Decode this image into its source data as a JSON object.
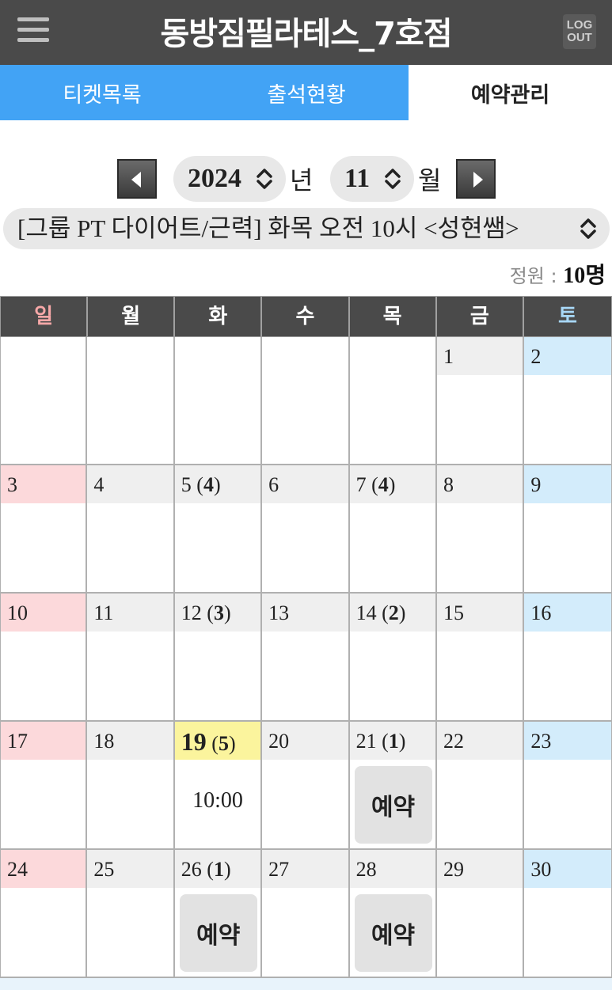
{
  "header": {
    "title": "동방짐필라테스_7호점",
    "logout_line1": "LOG",
    "logout_line2": "OUT"
  },
  "tabs": [
    {
      "label": "티켓목록",
      "active": false
    },
    {
      "label": "출석현황",
      "active": false
    },
    {
      "label": "예약관리",
      "active": true
    }
  ],
  "selector": {
    "year": "2024",
    "year_suffix": "년",
    "month": "11",
    "month_suffix": "월"
  },
  "class_select": "[그룹 PT 다이어트/근력] 화목 오전 10시 <성현쌤>",
  "capacity": {
    "label": "정원 : ",
    "value": "10명"
  },
  "weekdays": [
    "일",
    "월",
    "화",
    "수",
    "목",
    "금",
    "토"
  ],
  "weeks": [
    [
      {
        "date": "",
        "count": ""
      },
      {
        "date": "",
        "count": ""
      },
      {
        "date": "",
        "count": ""
      },
      {
        "date": "",
        "count": ""
      },
      {
        "date": "",
        "count": ""
      },
      {
        "date": "1",
        "count": ""
      },
      {
        "date": "2",
        "count": ""
      }
    ],
    [
      {
        "date": "3",
        "count": ""
      },
      {
        "date": "4",
        "count": ""
      },
      {
        "date": "5",
        "count": "4"
      },
      {
        "date": "6",
        "count": ""
      },
      {
        "date": "7",
        "count": "4"
      },
      {
        "date": "8",
        "count": ""
      },
      {
        "date": "9",
        "count": ""
      }
    ],
    [
      {
        "date": "10",
        "count": ""
      },
      {
        "date": "11",
        "count": ""
      },
      {
        "date": "12",
        "count": "3"
      },
      {
        "date": "13",
        "count": ""
      },
      {
        "date": "14",
        "count": "2"
      },
      {
        "date": "15",
        "count": ""
      },
      {
        "date": "16",
        "count": ""
      }
    ],
    [
      {
        "date": "17",
        "count": ""
      },
      {
        "date": "18",
        "count": ""
      },
      {
        "date": "19",
        "count": "5",
        "today": true,
        "time": "10:00"
      },
      {
        "date": "20",
        "count": ""
      },
      {
        "date": "21",
        "count": "1",
        "button": "예약"
      },
      {
        "date": "22",
        "count": ""
      },
      {
        "date": "23",
        "count": ""
      }
    ],
    [
      {
        "date": "24",
        "count": ""
      },
      {
        "date": "25",
        "count": ""
      },
      {
        "date": "26",
        "count": "1",
        "button": "예약"
      },
      {
        "date": "27",
        "count": ""
      },
      {
        "date": "28",
        "count": "",
        "button": "예약"
      },
      {
        "date": "29",
        "count": ""
      },
      {
        "date": "30",
        "count": ""
      }
    ]
  ],
  "colors": {
    "header_bg": "#4a4a4a",
    "tab_blue": "#42a3f5",
    "sunday_bg": "#fcd9db",
    "saturday_bg": "#d3ecfb",
    "today_bg": "#fbf49d",
    "date_bg": "#efefef"
  }
}
